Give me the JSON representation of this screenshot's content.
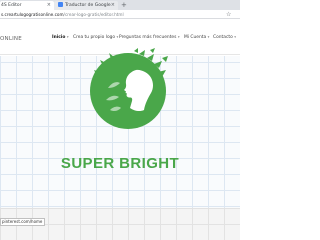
{
  "browser": {
    "tabs": [
      {
        "title": "4S Editor",
        "close": "×"
      },
      {
        "title": "Traductor de Google",
        "close": "×"
      }
    ],
    "new_tab": "+",
    "address": {
      "domain": "s.creartulogogratisonline.com",
      "path": "/crear-logo-gratis/editor.html"
    },
    "bookmark_icon": "star-icon",
    "status_text": "pinterest.com/home"
  },
  "site": {
    "brand": "ONLINE",
    "nav": [
      {
        "label": "Inicio",
        "caret": "▾",
        "active": true
      },
      {
        "label": "Crea tu propio logo",
        "caret": "▾",
        "active": false
      },
      {
        "label": "Preguntas más frecuentes",
        "caret": "▾",
        "active": false
      },
      {
        "label": "Mi Cuenta",
        "caret": "▾",
        "active": false
      },
      {
        "label": "Contacto",
        "caret": "▾",
        "active": false
      }
    ]
  },
  "logo": {
    "text": "SUPER BRIGHT",
    "color": "#4aa74a",
    "mark_icon": "woman-silhouette-butterflies-logo"
  }
}
